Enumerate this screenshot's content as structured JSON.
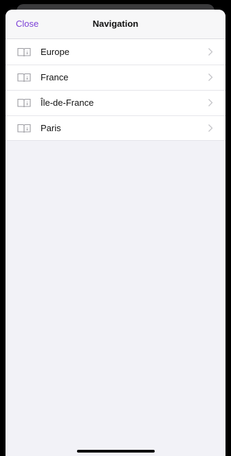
{
  "header": {
    "close_label": "Close",
    "title": "Navigation"
  },
  "list": {
    "items": [
      {
        "label": "Europe",
        "icon": "book-icon"
      },
      {
        "label": "France",
        "icon": "book-icon"
      },
      {
        "label": "Île-de-France",
        "icon": "book-icon"
      },
      {
        "label": "Paris",
        "icon": "book-icon"
      }
    ]
  },
  "colors": {
    "accent": "#7b3fd6",
    "sheet_background": "#f2f2f7",
    "icon_gray": "#9a9aa0"
  }
}
